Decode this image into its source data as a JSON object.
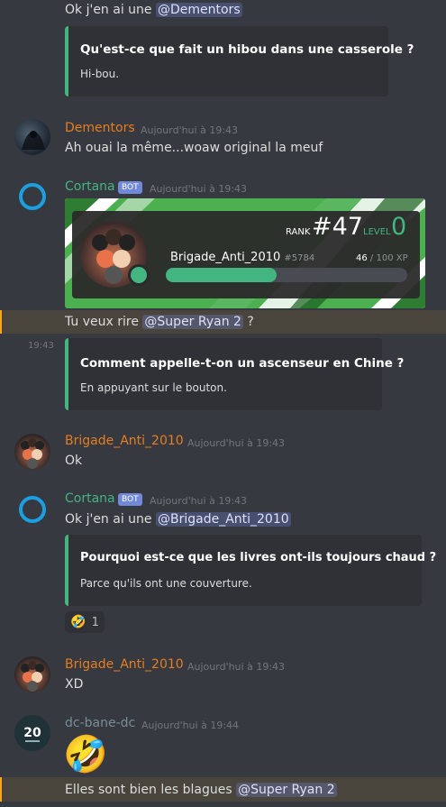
{
  "messages": {
    "m0": {
      "text": "Ok j'en ai une",
      "mention": "@Dementors"
    },
    "e0": {
      "title": "Qu'est-ce que fait un hibou dans une casserole ?",
      "desc": "Hi-bou."
    },
    "m1": {
      "username": "Dementors",
      "timestamp": "Aujourd'hui à 19:43",
      "text": "Ah ouai la même...woaw original la meuf",
      "color": "#e67e22"
    },
    "m2": {
      "username": "Cortana",
      "bot": "BOT",
      "timestamp": "Aujourd'hui à 19:43",
      "color": "#43b581"
    },
    "rank_card": {
      "rank_label": "RANK",
      "rank": "#47",
      "level_label": "LEVEL",
      "level": "0",
      "username": "Brigade_Anti_2010",
      "tag": "#5784",
      "xp": "46",
      "xp_max": "/ 100 XP",
      "progress": 0.46
    },
    "m3": {
      "text": "Tu veux rire",
      "mention": "@Super Ryan 2",
      "suffix": "?"
    },
    "m4": {
      "side_time": "19:43"
    },
    "e1": {
      "title": "Comment appelle-t-on un ascenseur en Chine ?",
      "desc": "En appuyant sur le bouton."
    },
    "m5": {
      "username": "Brigade_Anti_2010",
      "timestamp": "Aujourd'hui à 19:43",
      "text": "Ok",
      "color": "#e67e22"
    },
    "m6": {
      "username": "Cortana",
      "bot": "BOT",
      "timestamp": "Aujourd'hui à 19:43",
      "text": "Ok j'en ai une",
      "mention": "@Brigade_Anti_2010"
    },
    "e2": {
      "title": "Pourquoi est-ce que les livres ont-ils toujours chaud ?",
      "desc": "Parce qu'ils ont une couverture."
    },
    "reaction": {
      "emoji": "🤣",
      "count": "1"
    },
    "m7": {
      "username": "Brigade_Anti_2010",
      "timestamp": "Aujourd'hui à 19:43",
      "text": "XD"
    },
    "m8": {
      "username": "dc-bane-dc",
      "timestamp": "Aujourd'hui à 19:44",
      "emoji": "🤣",
      "color": "#7a8c96"
    },
    "m9": {
      "text": "Elles sont bien les blagues",
      "mention": "@Super Ryan 2"
    }
  },
  "icons": {
    "cortana": "cortana-ring-icon",
    "dementors": "dementors-avatar",
    "brigade": "brigade-avatar",
    "dcbane": "dc-bane-avatar"
  }
}
